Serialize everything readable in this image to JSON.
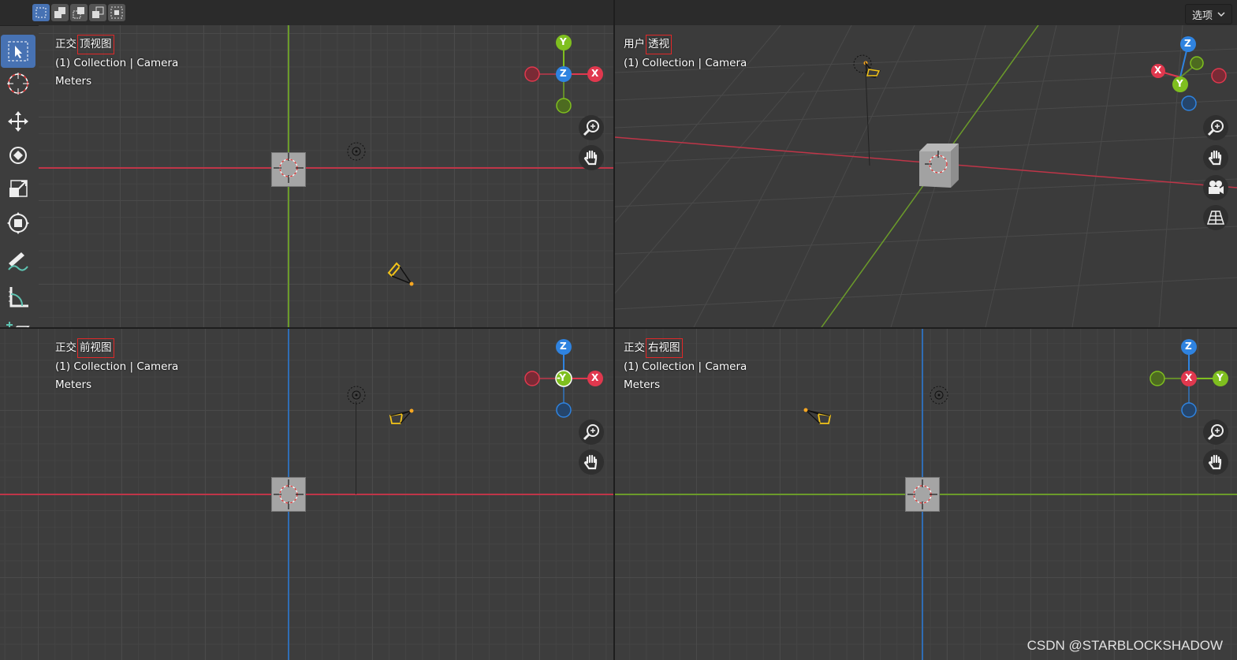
{
  "topbar": {
    "options_label": "选项",
    "selection_modes": [
      "select-box-new-icon",
      "select-extend-icon",
      "select-subtract-icon",
      "select-invert-icon",
      "select-intersect-icon"
    ]
  },
  "toolbar": {
    "tools": [
      "select-box-tool",
      "cursor-tool",
      "move-tool",
      "rotate-tool",
      "scale-tool",
      "transform-tool",
      "annotate-tool",
      "measure-tool",
      "add-cube-tool"
    ]
  },
  "viewports": {
    "top": {
      "title_prefix": "正交",
      "title_highlight": "顶视图",
      "collection": "(1) Collection | Camera",
      "units": "Meters",
      "gizmo": {
        "top": "Y",
        "center": "Z",
        "right": "X"
      }
    },
    "perspective": {
      "title_prefix": "用户",
      "title_highlight": "透视",
      "collection": "(1) Collection | Camera",
      "gizmo": {
        "top": "Z",
        "left": "X",
        "center": "Y"
      }
    },
    "front": {
      "title_prefix": "正交",
      "title_highlight": "前视图",
      "collection": "(1) Collection | Camera",
      "units": "Meters",
      "gizmo": {
        "top": "Z",
        "center": "-Y",
        "right": "X"
      }
    },
    "right": {
      "title_prefix": "正交",
      "title_highlight": "右视图",
      "collection": "(1) Collection | Camera",
      "units": "Meters",
      "gizmo": {
        "top": "Z",
        "center": "X",
        "right": "Y"
      }
    }
  },
  "colors": {
    "x_axis": "#e0384e",
    "y_axis": "#7fbf1f",
    "z_axis": "#2f83e0",
    "active_tool": "#4772b3",
    "highlight_box": "#e02828"
  },
  "watermark": "CSDN @STARBLOCKSHADOW"
}
